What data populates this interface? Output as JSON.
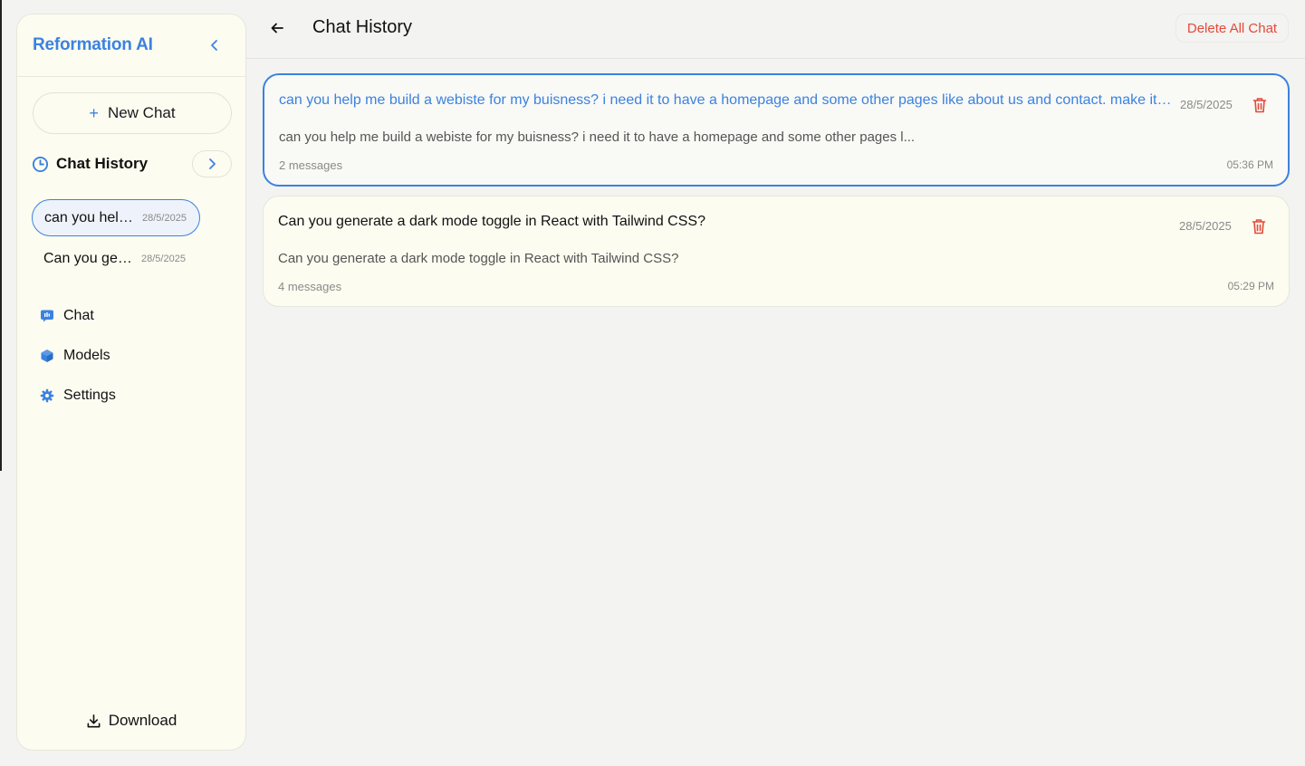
{
  "sidebar": {
    "brand": "Reformation AI",
    "new_chat_label": "New Chat",
    "history_title": "Chat History",
    "history_items": [
      {
        "title": "can you hel…",
        "date": "28/5/2025",
        "active": true
      },
      {
        "title": "Can you ge…",
        "date": "28/5/2025",
        "active": false
      }
    ],
    "nav": [
      {
        "label": "Chat",
        "icon": "chat-bubble-icon"
      },
      {
        "label": "Models",
        "icon": "cube-icon"
      },
      {
        "label": "Settings",
        "icon": "gear-icon"
      }
    ],
    "download_label": "Download"
  },
  "header": {
    "title": "Chat History",
    "delete_all_label": "Delete All Chat"
  },
  "chats": [
    {
      "title": "can you help me build a webiste for my buisness? i need it to have a homepage and some other pages like about us and contact. make it…",
      "date": "28/5/2025",
      "preview": "can you help me build a webiste for my buisness? i need it to have a homepage and some other pages l...",
      "message_count": "2 messages",
      "time": "05:36 PM",
      "active": true
    },
    {
      "title": "Can you generate a dark mode toggle in React with Tailwind CSS?",
      "date": "28/5/2025",
      "preview": "Can you generate a dark mode toggle in React with Tailwind CSS?",
      "message_count": "4 messages",
      "time": "05:29 PM",
      "active": false
    }
  ],
  "colors": {
    "accent": "#3b82e0",
    "danger": "#e24a3b",
    "sidebar_bg": "#fdfcf1",
    "page_bg": "#f3f3f1"
  }
}
